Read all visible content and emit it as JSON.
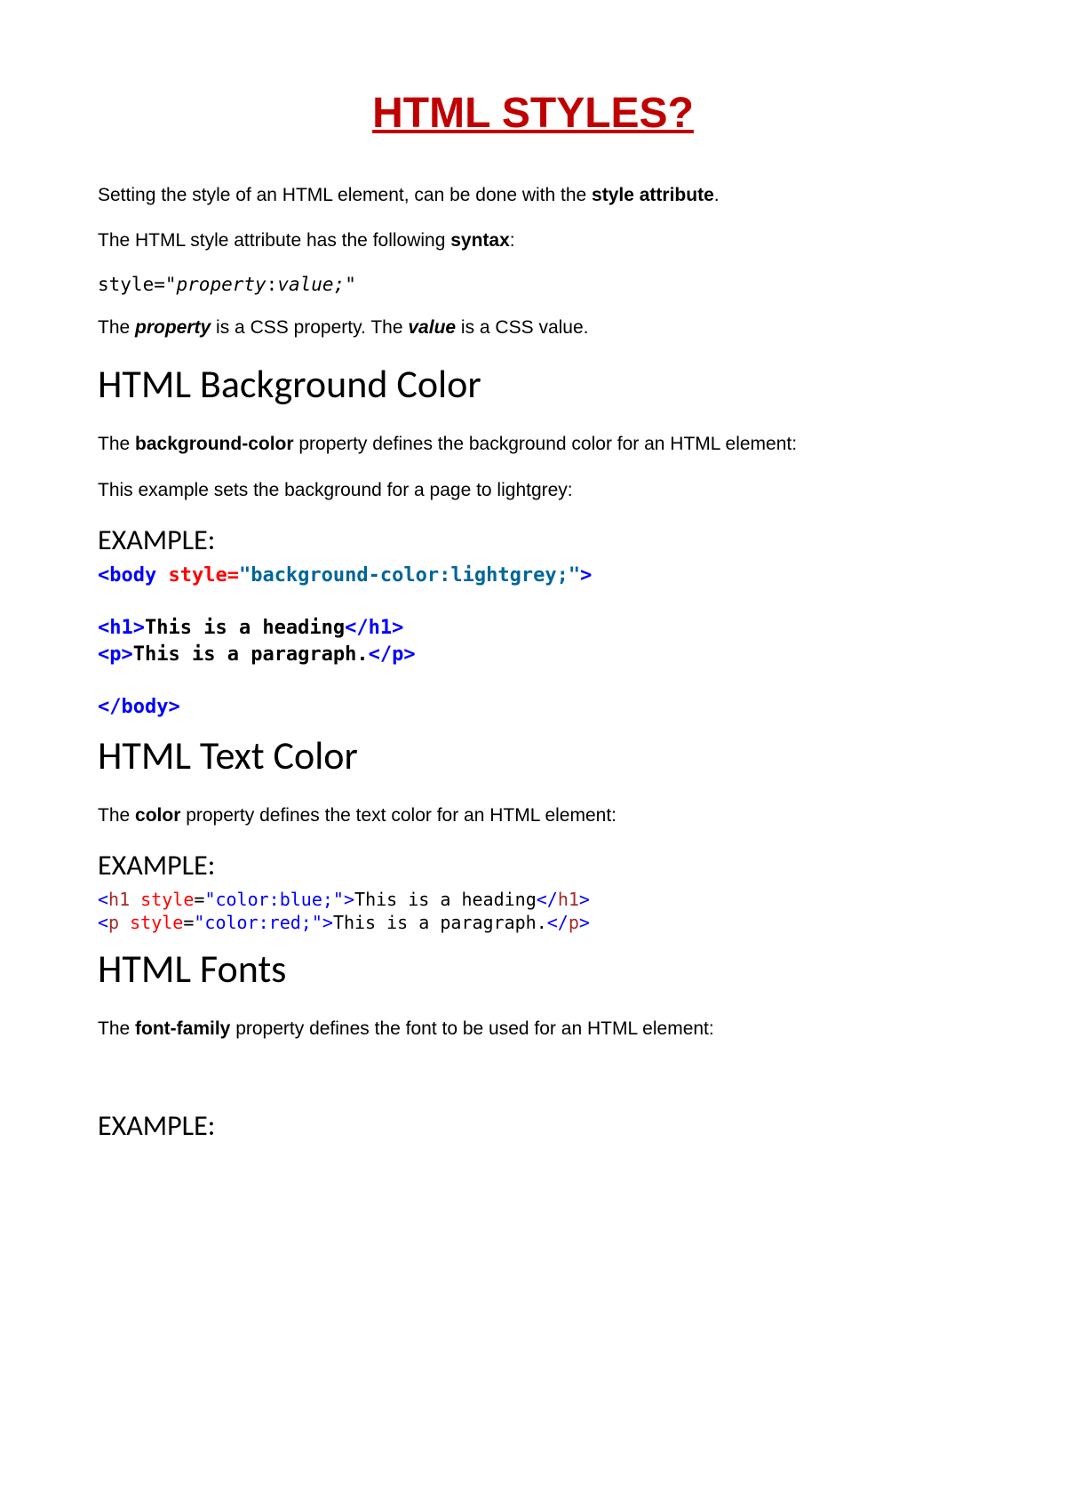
{
  "colors": {
    "title": "#C00000",
    "tag": "#0000FF",
    "attr_name": "#FF0000",
    "attr_value": "#006699",
    "tagname_thin": "#A52A2A",
    "attr_thin": "#FF0000",
    "val_thin": "#0000FF"
  },
  "title": "HTML STYLES?",
  "p1_a": "Setting the style of an HTML element, can be done with the ",
  "p1_b": "style attribute",
  "p1_c": ".",
  "p2_a": "The HTML style attribute has the following ",
  "p2_b": "syntax",
  "p2_c": ":",
  "code_syntax_a": "style=\"",
  "code_syntax_b": "property",
  "code_syntax_c": ":",
  "code_syntax_d": "value;",
  "code_syntax_e": "\"",
  "p3_a": "The ",
  "p3_b": "property",
  "p3_c": " is a CSS property. The ",
  "p3_d": "value",
  "p3_e": " is a CSS value.",
  "h_bg": "HTML Background Color",
  "p4_a": "The ",
  "p4_b": "background-color",
  "p4_c": " property defines the background color for an HTML element:",
  "p5": "This example sets the background for a page to lightgrey:",
  "ex_label": "EXAMPLE:",
  "ex1_l1_a": "<body",
  "ex1_l1_b": " style=",
  "ex1_l1_c": "\"background-color:lightgrey;\"",
  "ex1_l1_d": ">",
  "ex1_l3_a": "<h1>",
  "ex1_l3_b": "This is a heading",
  "ex1_l3_c": "</h1>",
  "ex1_l4_a": "<p>",
  "ex1_l4_b": "This is a paragraph.",
  "ex1_l4_c": "</p>",
  "ex1_l6": "</body>",
  "h_text": "HTML Text Color",
  "p6_a": "The ",
  "p6_b": "color",
  "p6_c": " property defines the text color for an HTML element:",
  "ex2_1_a": "<",
  "ex2_1_b": "h1",
  "ex2_1_c": " style",
  "ex2_1_d": "=",
  "ex2_1_e": "\"color:blue;\"",
  "ex2_1_f": ">",
  "ex2_1_g": "This is a heading",
  "ex2_1_h": "</",
  "ex2_1_i": "h1",
  "ex2_1_j": ">",
  "ex2_2_a": "<",
  "ex2_2_b": "p",
  "ex2_2_c": " style",
  "ex2_2_d": "=",
  "ex2_2_e": "\"color:red;\"",
  "ex2_2_f": ">",
  "ex2_2_g": "This is a paragraph.",
  "ex2_2_h": "</",
  "ex2_2_i": "p",
  "ex2_2_j": ">",
  "h_fonts": "HTML Fonts",
  "p7_a": "The ",
  "p7_b": "font-family",
  "p7_c": " property defines the font to be used for an HTML element:"
}
